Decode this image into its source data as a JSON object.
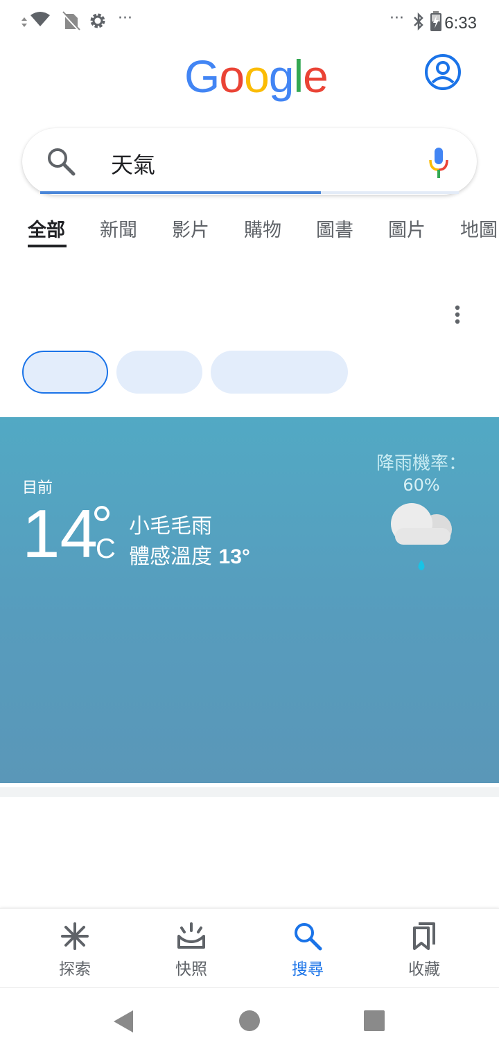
{
  "status_bar": {
    "time": "6:33",
    "overflow_left": "···",
    "overflow_right": "···"
  },
  "header": {
    "logo_letters": [
      {
        "ch": "G",
        "color": "#4285F4"
      },
      {
        "ch": "o",
        "color": "#EA4335"
      },
      {
        "ch": "o",
        "color": "#FBBC05"
      },
      {
        "ch": "g",
        "color": "#4285F4"
      },
      {
        "ch": "l",
        "color": "#34A853"
      },
      {
        "ch": "e",
        "color": "#EA4335"
      }
    ],
    "account_icon": "account-circle-icon"
  },
  "search": {
    "query": "天氣",
    "icon": "search-icon",
    "mic_icon": "mic-icon",
    "loading_progress": 0.67
  },
  "tabs": [
    "全部",
    "新聞",
    "影片",
    "購物",
    "圖書",
    "圖片",
    "地圖"
  ],
  "active_tab": 0,
  "weather": {
    "label_now": "目前",
    "temp": "14",
    "unit": "C",
    "condition": "小毛毛雨",
    "feels_like_label": "體感溫度",
    "feels_like_value": "13°",
    "rain_label": "降雨機率：",
    "rain_value": "60%",
    "icon": "drizzle-cloud-icon",
    "background_color": "#559fc0"
  },
  "bottom_nav": {
    "items": [
      {
        "label": "探索",
        "icon": "asterisk-icon"
      },
      {
        "label": "快照",
        "icon": "snapshot-icon"
      },
      {
        "label": "搜尋",
        "icon": "search-icon"
      },
      {
        "label": "收藏",
        "icon": "bookmarks-icon"
      }
    ],
    "active": 2,
    "active_color": "#1a73e8"
  },
  "system_nav": {
    "back": "back-icon",
    "home": "home-icon",
    "recents": "recents-icon"
  }
}
